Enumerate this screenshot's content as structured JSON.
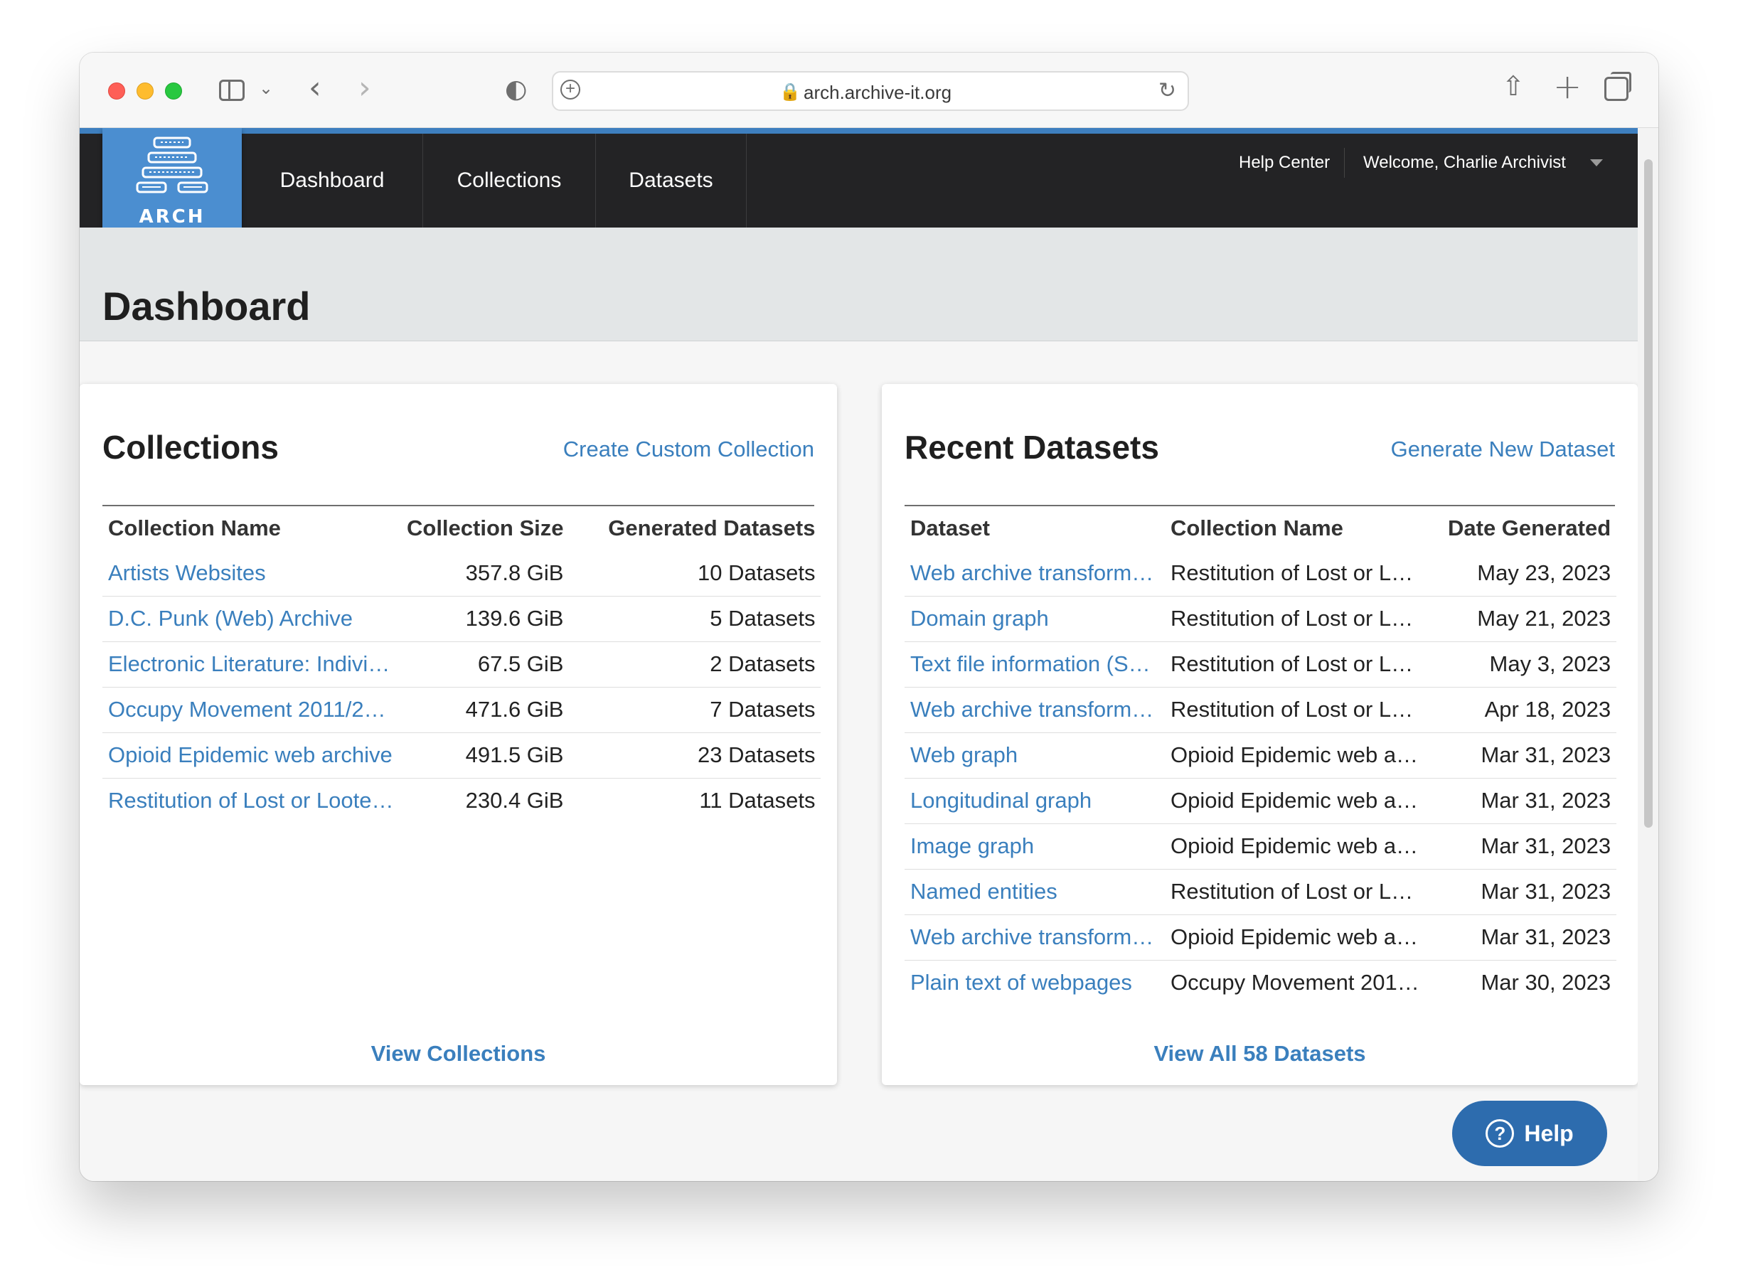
{
  "browser": {
    "url": "arch.archive-it.org"
  },
  "nav": {
    "logo_text": "ARCH",
    "items": [
      {
        "label": "Dashboard"
      },
      {
        "label": "Collections"
      },
      {
        "label": "Datasets"
      }
    ],
    "help_center": "Help Center",
    "welcome": "Welcome, Charlie Archivist"
  },
  "page": {
    "title": "Dashboard"
  },
  "collections": {
    "title": "Collections",
    "action": "Create Custom Collection",
    "headers": [
      "Collection Name",
      "Collection Size",
      "Generated Datasets"
    ],
    "rows": [
      {
        "name": "Artists Websites",
        "size": "357.8 GiB",
        "datasets": "10 Datasets"
      },
      {
        "name": "D.C. Punk (Web) Archive",
        "size": "139.6 GiB",
        "datasets": "5 Datasets"
      },
      {
        "name": "Electronic Literature: Indivi…",
        "size": "67.5 GiB",
        "datasets": "2 Datasets"
      },
      {
        "name": "Occupy Movement 2011/2…",
        "size": "471.6 GiB",
        "datasets": "7 Datasets"
      },
      {
        "name": "Opioid Epidemic web archive",
        "size": "491.5 GiB",
        "datasets": "23 Datasets"
      },
      {
        "name": "Restitution of Lost or Loote…",
        "size": "230.4 GiB",
        "datasets": "11 Datasets"
      }
    ],
    "footer": "View Collections"
  },
  "datasets": {
    "title": "Recent Datasets",
    "action": "Generate New Dataset",
    "headers": [
      "Dataset",
      "Collection Name",
      "Date Generated"
    ],
    "rows": [
      {
        "dataset": "Web archive transform…",
        "collection": "Restitution of Lost or L…",
        "date": "May 23, 2023"
      },
      {
        "dataset": "Domain graph",
        "collection": "Restitution of Lost or L…",
        "date": "May 21, 2023"
      },
      {
        "dataset": "Text file information (S…",
        "collection": "Restitution of Lost or L…",
        "date": "May 3, 2023"
      },
      {
        "dataset": "Web archive transform…",
        "collection": "Restitution of Lost or L…",
        "date": "Apr 18, 2023"
      },
      {
        "dataset": "Web graph",
        "collection": "Opioid Epidemic web a…",
        "date": "Mar 31, 2023"
      },
      {
        "dataset": "Longitudinal graph",
        "collection": "Opioid Epidemic web a…",
        "date": "Mar 31, 2023"
      },
      {
        "dataset": "Image graph",
        "collection": "Opioid Epidemic web a…",
        "date": "Mar 31, 2023"
      },
      {
        "dataset": "Named entities",
        "collection": "Restitution of Lost or L…",
        "date": "Mar 31, 2023"
      },
      {
        "dataset": "Web archive transform…",
        "collection": "Opioid Epidemic web a…",
        "date": "Mar 31, 2023"
      },
      {
        "dataset": "Plain text of webpages",
        "collection": "Occupy Movement 201…",
        "date": "Mar 30, 2023"
      }
    ],
    "footer": "View All 58 Datasets"
  },
  "help_button": {
    "label": "Help",
    "icon": "question-circle-icon"
  }
}
